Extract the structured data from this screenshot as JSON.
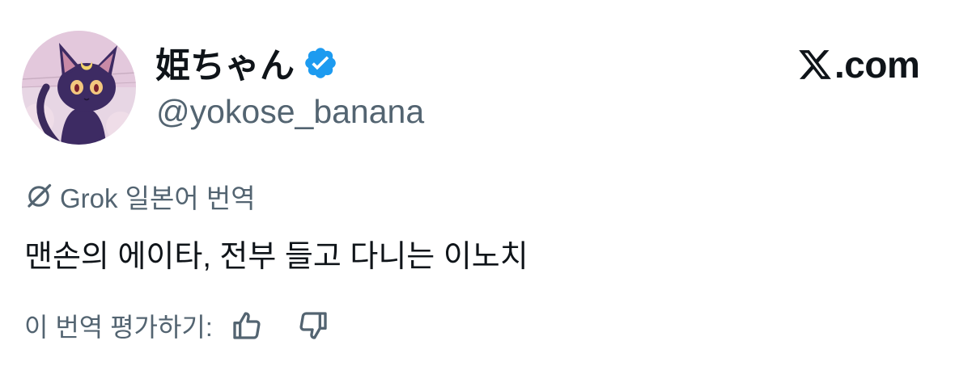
{
  "user": {
    "display_name": "姫ちゃん",
    "handle": "@yokose_banana",
    "verified": true,
    "avatar_icon": "black-cat-luna-avatar"
  },
  "brand": {
    "text": ".com",
    "icon": "x-logo-icon"
  },
  "translation": {
    "icon": "grok-icon",
    "label": "Grok 일본어 번역"
  },
  "tweet": {
    "text": "맨손의 에이타, 전부 들고 다니는 이노치"
  },
  "rating": {
    "prompt": "이 번역 평가하기:",
    "up_icon": "thumbs-up-icon",
    "down_icon": "thumbs-down-icon"
  },
  "colors": {
    "primary_text": "#0f1419",
    "secondary_text": "#536471",
    "verified_blue": "#1d9bf0",
    "background": "#ffffff"
  }
}
